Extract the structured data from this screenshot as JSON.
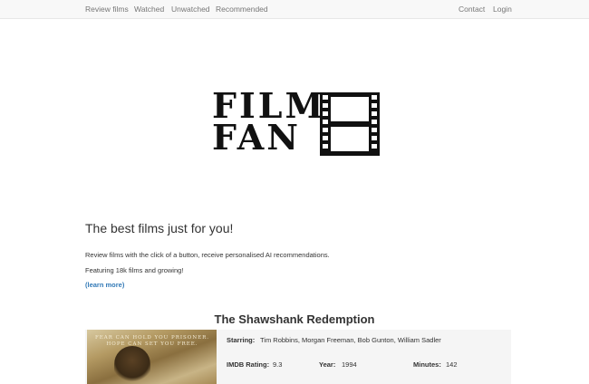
{
  "navbar": {
    "left_links": [
      "Review films",
      "Watched",
      "Unwatched",
      "Recommended"
    ],
    "right_links": [
      "Contact",
      "Login"
    ]
  },
  "logo": {
    "line1": "FILM",
    "line2": "FAN"
  },
  "hero": {
    "tagline": "The best films just for you!",
    "description": "Review films with the click of a button, receive personalised AI recommendations.",
    "featuring": "Featuring 18k films and growing!",
    "learn_more": "(learn more)"
  },
  "film": {
    "title": "The Shawshank Redemption",
    "poster_line1": "FEAR CAN HOLD YOU PRISONER.",
    "poster_line2": "HOPE CAN SET YOU FREE.",
    "starring_label": "Starring:",
    "starring": "Tim Robbins, Morgan Freeman, Bob Gunton, William Sadler",
    "imdb_label": "IMDB Rating:",
    "imdb": "9.3",
    "year_label": "Year:",
    "year": "1994",
    "minutes_label": "Minutes:",
    "minutes": "142"
  },
  "colors": {
    "navbar_bg": "#f8f8f8",
    "nav_text": "#777777",
    "link": "#337ab7",
    "card_bg": "#f5f5f5"
  }
}
